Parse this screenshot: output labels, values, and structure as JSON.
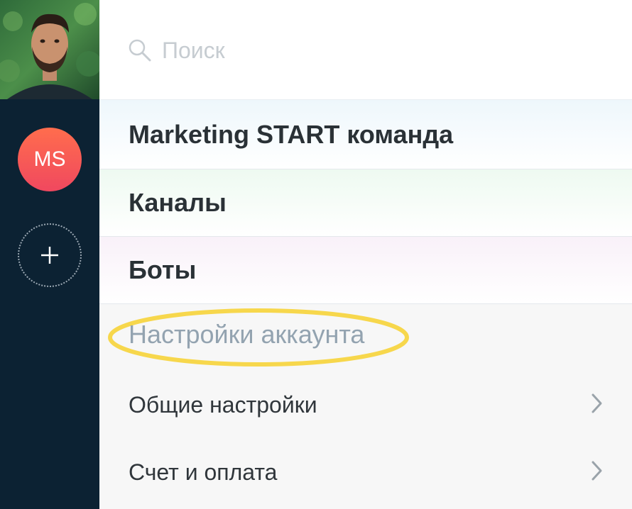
{
  "rail": {
    "team_badge": "MS",
    "badge_colors": [
      "#ff6d4d",
      "#f0485f"
    ],
    "add_icon": "plus-icon"
  },
  "search": {
    "placeholder": "Поиск",
    "icon": "search-icon"
  },
  "sections": [
    "Marketing START команда",
    "Каналы",
    "Боты"
  ],
  "account_settings": {
    "title": "Настройки аккаунта",
    "highlight_color": "#f7d74c",
    "items": [
      {
        "label": "Общие настройки",
        "icon": "chevron-right-icon"
      },
      {
        "label": "Счет и оплата",
        "icon": "chevron-right-icon"
      }
    ]
  }
}
